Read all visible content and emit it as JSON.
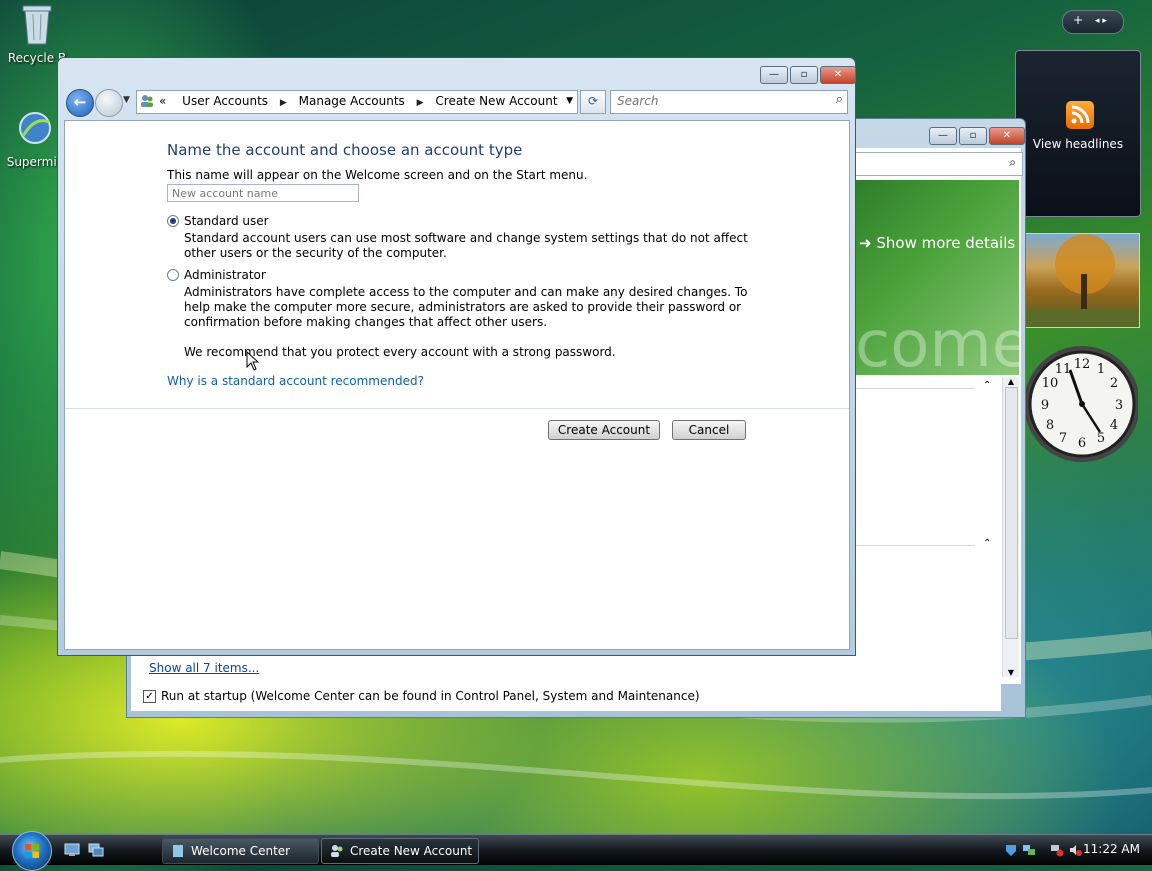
{
  "desktop": {
    "icons": [
      {
        "label": "Recycle B"
      },
      {
        "label": "Supermic"
      }
    ]
  },
  "sidebar": {
    "add_symbol": "+",
    "nav_symbol": "◂ ▸",
    "feed_text": "View headlines",
    "clock_numbers": [
      "12",
      "1",
      "2",
      "3",
      "4",
      "5",
      "6",
      "7",
      "8",
      "9",
      "10",
      "11"
    ]
  },
  "welcome_window": {
    "show_more": "Show more details",
    "banner_word": "come",
    "show_all": "Show all 7 items...",
    "run_startup": "Run at startup (Welcome Center can be found in Control Panel, System and Maintenance)",
    "run_startup_checked": true
  },
  "create_window": {
    "breadcrumb_prefix": "«",
    "breadcrumbs": [
      "User Accounts",
      "Manage Accounts",
      "Create New Account"
    ],
    "search_placeholder": "Search",
    "heading": "Name the account and choose an account type",
    "subtext": "This name will appear on the Welcome screen and on the Start menu.",
    "name_placeholder": "New account name",
    "options": [
      {
        "label": "Standard user",
        "selected": true,
        "description": "Standard account users can use most software and change system settings that do not affect other users or the security of the computer."
      },
      {
        "label": "Administrator",
        "selected": false,
        "description": "Administrators have complete access to the computer and can make any desired changes. To help make the computer more secure, administrators are asked to provide their password or confirmation before making changes that affect other users."
      }
    ],
    "recommendation": "We recommend that you protect every account with a strong password.",
    "help_link": "Why is a standard account recommended?",
    "create_button": "Create Account",
    "cancel_button": "Cancel"
  },
  "taskbar": {
    "buttons": [
      {
        "label": "Welcome Center",
        "active": false
      },
      {
        "label": "Create New Account",
        "active": true
      }
    ],
    "time": "11:22 AM"
  },
  "colors": {
    "heading": "#1d3f7a",
    "link": "#1160a6",
    "close_button": "#c4432a"
  }
}
